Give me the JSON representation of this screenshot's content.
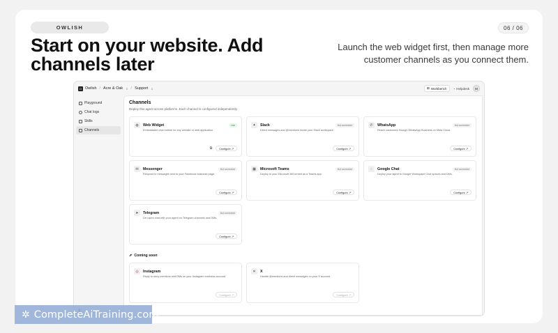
{
  "slide": {
    "brand": "OWLISH",
    "page_counter": "06 / 06",
    "headline": "Start on your website. Add channels later",
    "subline": "Launch the web widget first, then manage more customer channels as you connect them."
  },
  "app": {
    "topbar": {
      "logo": "O",
      "app_name": "Owlish",
      "workspace": "Acre & Oak",
      "agent": "Support",
      "workbench_label": "Workbench",
      "helpdesk_label": "Helpdesk",
      "avatar_initial": "M"
    },
    "sidebar": {
      "items": [
        {
          "label": "Playground",
          "icon": "playground-icon"
        },
        {
          "label": "Chat logs",
          "icon": "chat-icon"
        },
        {
          "label": "Skills",
          "icon": "skills-icon"
        },
        {
          "label": "Channels",
          "icon": "channels-icon",
          "active": true
        }
      ]
    },
    "main": {
      "title": "Channels",
      "subtitle": "Deploy this agent across platforms. Each channel is configured independently.",
      "configure_label": "Configure ↗",
      "channels": [
        {
          "name": "Web Widget",
          "status": "Live",
          "desc": "Embeddable chat bubble for any website or web application.",
          "icon": "globe-icon",
          "glyph": "◍"
        },
        {
          "name": "Slack",
          "status": "Not connected",
          "desc": "Direct messages and @mentions inside your Slack workspace.",
          "icon": "slack-icon",
          "glyph": "✦"
        },
        {
          "name": "WhatsApp",
          "status": "Not connected",
          "desc": "Reach customers through WhatsApp Business on Meta Cloud.",
          "icon": "whatsapp-icon",
          "glyph": "✆"
        },
        {
          "name": "Messenger",
          "status": "Not connected",
          "desc": "Respond to messages sent to your Facebook business page.",
          "icon": "messenger-icon",
          "glyph": "✉"
        },
        {
          "name": "Microsoft Teams",
          "status": "Not connected",
          "desc": "Deploy to your Microsoft 365 tenant as a Teams app.",
          "icon": "teams-icon",
          "glyph": "▦"
        },
        {
          "name": "Google Chat",
          "status": "Not connected",
          "desc": "Deploy your agent to Google Workspace Chat spaces and DMs.",
          "icon": "google-chat-icon",
          "glyph": "◌"
        },
        {
          "name": "Telegram",
          "status": "Not connected",
          "desc": "Let users chat with your agent on Telegram channels and DMs.",
          "icon": "telegram-icon",
          "glyph": "➤"
        }
      ],
      "coming_soon_label": "Coming soon",
      "coming_soon": [
        {
          "name": "Instagram",
          "desc": "Reply to story mentions and DMs on your Instagram business account.",
          "icon": "instagram-icon",
          "glyph": "◎"
        },
        {
          "name": "X",
          "desc": "Handle @mentions and direct messages on your X account.",
          "icon": "x-icon",
          "glyph": "✕"
        }
      ]
    }
  },
  "watermark": {
    "text": "CompleteAiTraining.com"
  }
}
